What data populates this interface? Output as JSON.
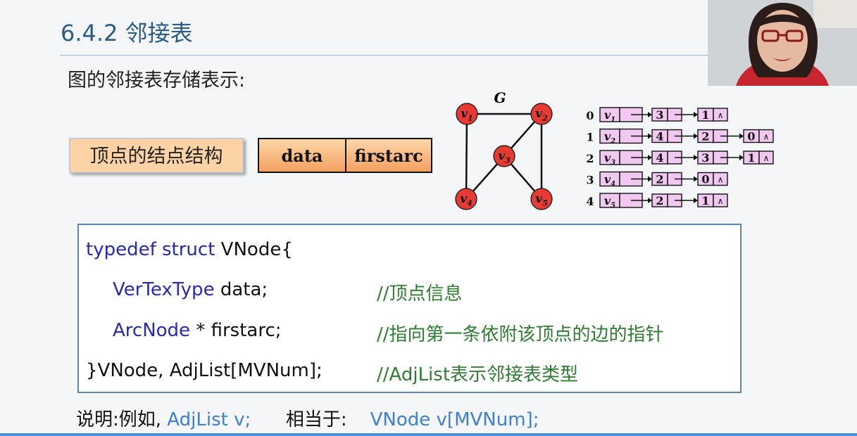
{
  "slide": {
    "title": "6.4.2 邻接表",
    "subtitle": "图的邻接表存储表示:",
    "node_label": "顶点的结点结构",
    "node_fields": [
      "data",
      "firstarc"
    ]
  },
  "graph": {
    "name": "G",
    "vertices": [
      {
        "id": "v1",
        "letter": "v",
        "sub": "1"
      },
      {
        "id": "v2",
        "letter": "v",
        "sub": "2"
      },
      {
        "id": "v3",
        "letter": "v",
        "sub": "3"
      },
      {
        "id": "v4",
        "letter": "v",
        "sub": "4"
      },
      {
        "id": "v5",
        "letter": "v",
        "sub": "5"
      }
    ],
    "edges": [
      [
        "v1",
        "v2"
      ],
      [
        "v1",
        "v4"
      ],
      [
        "v2",
        "v3"
      ],
      [
        "v2",
        "v5"
      ],
      [
        "v3",
        "v4"
      ],
      [
        "v3",
        "v5"
      ]
    ],
    "node_color": "#e63b33"
  },
  "adjlist": {
    "rows": [
      {
        "index": "0",
        "letter": "v",
        "sub": "1",
        "arcs": [
          "3",
          "1"
        ]
      },
      {
        "index": "1",
        "letter": "v",
        "sub": "2",
        "arcs": [
          "4",
          "2",
          "0"
        ]
      },
      {
        "index": "2",
        "letter": "v",
        "sub": "3",
        "arcs": [
          "4",
          "3",
          "1"
        ]
      },
      {
        "index": "3",
        "letter": "v",
        "sub": "4",
        "arcs": [
          "2",
          "0"
        ]
      },
      {
        "index": "4",
        "letter": "v",
        "sub": "5",
        "arcs": [
          "2",
          "1"
        ]
      }
    ],
    "null_symbol": "∧",
    "fill_color": "#f0c8f0"
  },
  "code": {
    "l1_kw": "typedef struct ",
    "l1_rest": "VNode{",
    "l2_type": "VerTexType",
    "l2_rest": " data;",
    "l2_comment": "//顶点信息",
    "l3_type": "ArcNode",
    "l3_rest": " * firstarc;",
    "l3_comment": "//指向第一条依附该顶点的边的指针",
    "l4_code": "}VNode, AdjList[MVNum];",
    "l4_comment": "//AdjList表示邻接表类型"
  },
  "note": {
    "prefix": "说明:例如, ",
    "example": "AdjList v;",
    "middle": "相当于: ",
    "equiv": "VNode v[MVNum];"
  },
  "colors": {
    "title": "#2a5c86",
    "keyword": "#2727b8",
    "comment": "#2e7d32",
    "note_blue": "#3d7fd4",
    "code_border": "#5b85b8"
  }
}
